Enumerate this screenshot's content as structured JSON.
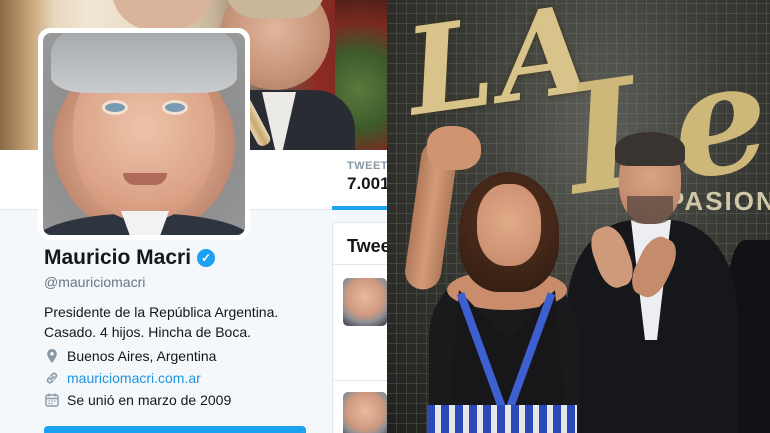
{
  "profile": {
    "name": "Mauricio Macri",
    "handle": "@mauriciomacri",
    "bio_line1": "Presidente de la República Argentina.",
    "bio_line2": "Casado. 4 hijos. Hincha de Boca.",
    "location": "Buenos Aires, Argentina",
    "website": "mauriciomacri.com.ar",
    "joined": "Se unió en marzo de 2009",
    "verified_icon": "verified-badge-icon"
  },
  "stats": {
    "tweets_label": "TWEET",
    "tweets_count": "7.001"
  },
  "timeline": {
    "title": "Twee"
  },
  "stage": {
    "sign_line1": "LA",
    "sign_line2": "Le",
    "sign_sub": "PASION, E"
  },
  "colors": {
    "accent": "#1da1f2",
    "link": "#1b95e0",
    "background": "#f5f8fa"
  }
}
